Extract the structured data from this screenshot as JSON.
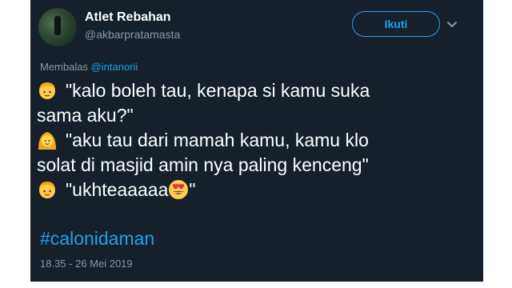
{
  "author": {
    "name": "Atlet Rebahan",
    "handle": "@akbarpratamasta"
  },
  "follow_button": {
    "label": "Ikuti"
  },
  "reply": {
    "prefix": "Membalas",
    "mention": "@intanorii"
  },
  "tweet": {
    "lines": [
      "\"kalo boleh tau, kenapa si kamu suka",
      "sama aku?\"",
      "\"aku tau dari mamah kamu, kamu klo",
      "solat di masjid amin nya paling kenceng\"",
      "\"ukhteaaaaa",
      "\""
    ],
    "hashtag": "#calonidaman",
    "timestamp": "18.35 - 26 Mei 2019"
  },
  "icons": {
    "boy": "boy-emoji-icon",
    "woman_veil": "woman-headscarf-emoji-icon",
    "heart_eyes": "heart-eyes-emoji-icon",
    "chevron": "chevron-down-icon"
  },
  "colors": {
    "background": "#15202b",
    "accent": "#1da1f2",
    "muted": "#8899a6",
    "text": "#ffffff"
  }
}
